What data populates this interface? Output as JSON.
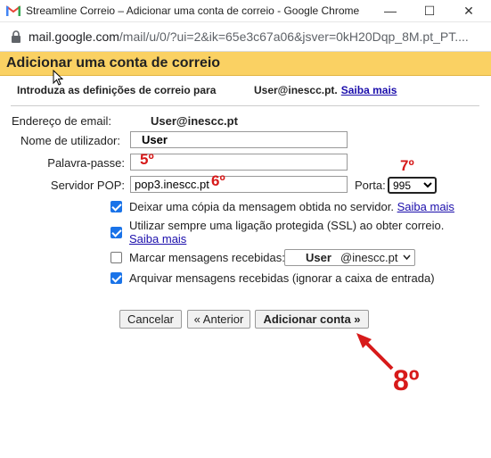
{
  "window": {
    "title": "Streamline Correio – Adicionar uma conta de correio - Google Chrome",
    "minimize": "—",
    "maximize": "☐",
    "close": "✕"
  },
  "url": {
    "host": "mail.google.com",
    "path": "/mail/u/0/?ui=2&ik=65e3c67a06&jsver=0kH20Dqp_8M.pt_PT...."
  },
  "page": {
    "heading": "Adicionar uma conta de correio",
    "subtitle": "Introduza as definições de correio para",
    "subtitle_email": "User@inescc.pt.",
    "learn_more": "Saiba mais"
  },
  "form": {
    "email_label": "Endereço de email:",
    "email_value": "User@inescc.pt",
    "username_label": "Nome de utilizador:",
    "username_value": "User",
    "password_label": "Palavra-passe:",
    "password_value": "",
    "pop_label": "Servidor POP:",
    "pop_value": "pop3.inescc.pt",
    "port_label": "Porta:",
    "port_value": "995",
    "options": {
      "leave_copy": "Deixar uma cópia da mensagem obtida no servidor.",
      "leave_copy_link": "Saiba mais",
      "use_ssl": "Utilizar sempre uma ligação protegida (SSL) ao obter correio.",
      "use_ssl_link": "Saiba mais",
      "label_incoming": "Marcar mensagens recebidas:",
      "label_user": "User",
      "label_domain": "@inescc.pt",
      "archive": "Arquivar mensagens recebidas (ignorar a caixa de entrada)"
    },
    "checks": {
      "leave_copy": true,
      "use_ssl": true,
      "label_incoming": false,
      "archive": true
    }
  },
  "buttons": {
    "cancel": "Cancelar",
    "back": "« Anterior",
    "add": "Adicionar conta »"
  },
  "annotations": {
    "step5": "5º",
    "step6": "6º",
    "step7": "7º",
    "step8": "8º",
    "color": "#d71a1a"
  }
}
